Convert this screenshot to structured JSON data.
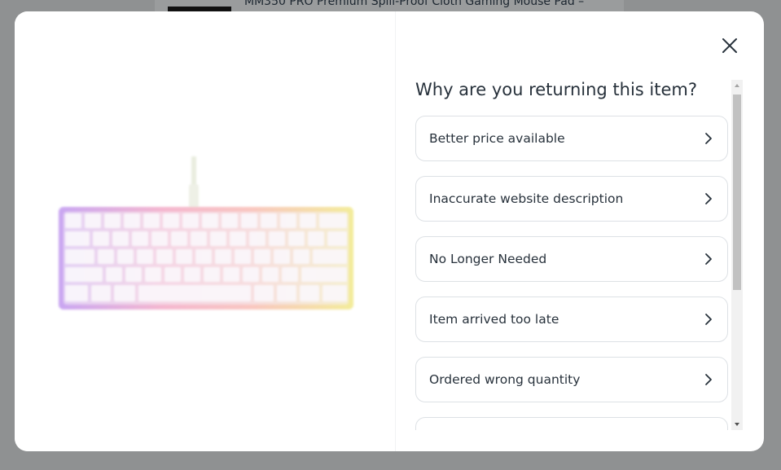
{
  "background": {
    "product_title": "MM350 PRO Premium Spill-Proof Cloth Gaming Mouse Pad –"
  },
  "modal": {
    "product_image_icon": "keyboard-product-image",
    "close_icon": "close-icon",
    "question": "Why are you returning this item?",
    "reasons": [
      {
        "label": "Better price available"
      },
      {
        "label": "Inaccurate website description"
      },
      {
        "label": "No Longer Needed"
      },
      {
        "label": "Item arrived too late"
      },
      {
        "label": "Ordered wrong quantity"
      },
      {
        "label": ""
      }
    ]
  },
  "colors": {
    "overlay": "#8f9192",
    "text": "#27313b",
    "border": "#dde1e5"
  }
}
